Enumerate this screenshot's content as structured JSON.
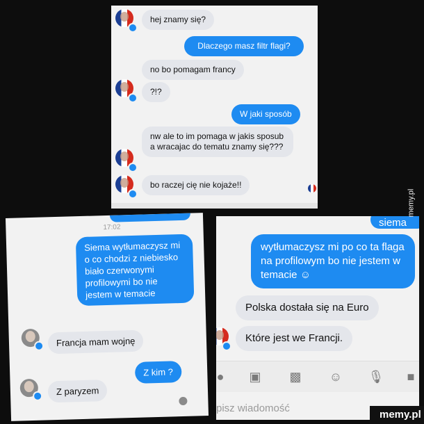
{
  "panel1": {
    "messages": [
      "hej znamy się?",
      "Dlaczego masz filtr flagi?",
      "no bo pomagam francy",
      "?!?",
      "W jaki sposób",
      "nw ale to im pomaga w jakis sposub a wracajac do tematu znamy się???",
      "bo raczej cię nie kojaże!!"
    ]
  },
  "panel2": {
    "time": "17:02",
    "messages": [
      "Siema wytłumaczysz mi o co chodzi z niebiesko biało czerwonymi profilowymi bo nie jestem w temacie",
      "Francja mam wojnę",
      "Z kim ?",
      "Z paryzem"
    ]
  },
  "panel3": {
    "top_partial": "siema",
    "messages": [
      "wytłumaczysz mi po co ta flaga na profilowym bo nie jestem w temacie ☺",
      "Polska dostała się na Euro",
      "Które jest we Francji."
    ],
    "input_placeholder": "pisz wiadomość"
  },
  "watermark": {
    "side": "memy.pl",
    "corner": "memy.pl"
  },
  "colors": {
    "outgoing": "#1e8bf1",
    "incoming": "#e4e6eb",
    "background": "#0d0d0d"
  }
}
